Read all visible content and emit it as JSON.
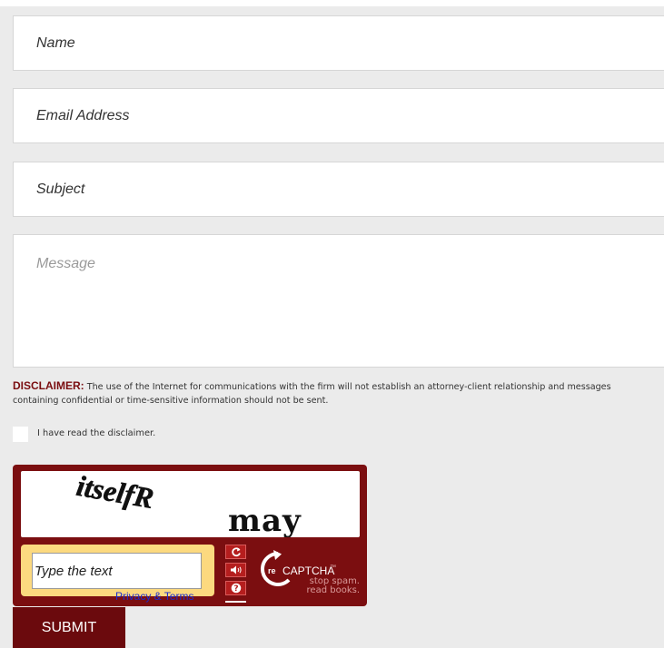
{
  "form": {
    "name_placeholder": "Name",
    "email_placeholder": "Email Address",
    "subject_placeholder": "Subject",
    "message_placeholder": "Message"
  },
  "disclaimer": {
    "label": "DISCLAIMER:",
    "text": " The use of the Internet for communications with the firm will not establish an attorney-client relationship and messages containing confidential or time-sensitive information should not be sent."
  },
  "acknowledge": {
    "label": "I have read the disclaimer.",
    "checked": false
  },
  "captcha": {
    "word1": "itselfR",
    "word2": "may",
    "input_placeholder": "Type the text",
    "privacy_link": "Privacy & Terms",
    "logo_text": "CAPTCHA",
    "logo_prefix": "re",
    "tm": "™",
    "tagline_1": "stop spam.",
    "tagline_2": "read books.",
    "refresh_icon": "refresh-icon",
    "audio_icon": "audio-icon",
    "help_icon": "help-icon"
  },
  "submit_label": "SUBMIT",
  "colors": {
    "brand": "#7b0e10",
    "submit": "#6b0a0d",
    "disclaimer_label": "#7a0d10",
    "page_bg": "#ebebeb",
    "captcha_input_frame": "#fcd97f",
    "link": "#1a2cd0"
  }
}
